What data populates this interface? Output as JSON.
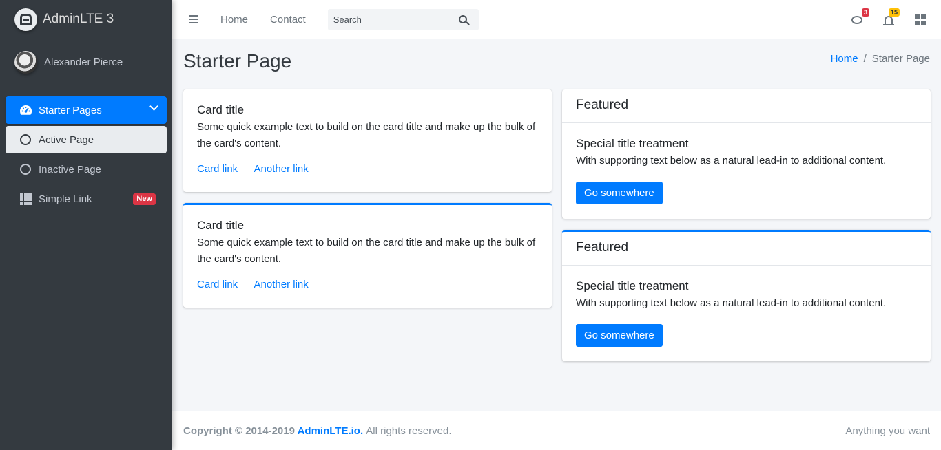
{
  "brand": {
    "name": "AdminLTE 3"
  },
  "user": {
    "name": "Alexander Pierce"
  },
  "sidebar": {
    "items": [
      {
        "label": "Starter Pages"
      },
      {
        "label": "Active Page"
      },
      {
        "label": "Inactive Page"
      },
      {
        "label": "Simple Link",
        "badge": "New"
      }
    ]
  },
  "navbar": {
    "links": [
      "Home",
      "Contact"
    ],
    "search_placeholder": "Search",
    "messages_count": "3",
    "notifications_count": "15"
  },
  "page": {
    "title": "Starter Page",
    "breadcrumb": [
      "Home",
      "Starter Page"
    ]
  },
  "cards_left": [
    {
      "title": "Card title",
      "text": "Some quick example text to build on the card title and make up the bulk of the card's content.",
      "link1": "Card link",
      "link2": "Another link"
    },
    {
      "title": "Card title",
      "text": "Some quick example text to build on the card title and make up the bulk of the card's content.",
      "link1": "Card link",
      "link2": "Another link"
    }
  ],
  "cards_right": [
    {
      "header": "Featured",
      "title": "Special title treatment",
      "text": "With supporting text below as a natural lead-in to additional content.",
      "button": "Go somewhere"
    },
    {
      "header": "Featured",
      "title": "Special title treatment",
      "text": "With supporting text below as a natural lead-in to additional content.",
      "button": "Go somewhere"
    }
  ],
  "footer": {
    "copyright": "Copyright © 2014-2019",
    "brand_link": "AdminLTE.io.",
    "rights": "All rights reserved.",
    "right_text": "Anything you want"
  },
  "colors": {
    "primary": "#007bff",
    "sidebar": "#343a40",
    "danger": "#dc3545",
    "warning": "#ffc107"
  },
  "icons": [
    "bars-icon",
    "search-icon",
    "comments-icon",
    "bell-icon",
    "th-large-icon",
    "tachometer-icon",
    "circle-icon",
    "th-icon",
    "angle-down-icon"
  ]
}
